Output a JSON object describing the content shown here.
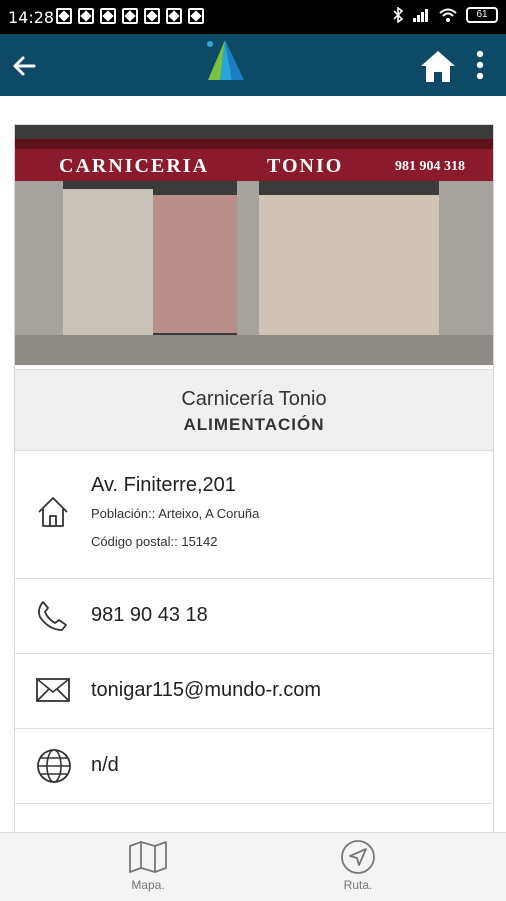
{
  "status_bar": {
    "time": "14:28",
    "battery": "61"
  },
  "appbar": {
    "back_icon": "arrow-left-icon",
    "logo_icon": "app-logo-icon",
    "home_icon": "home-icon",
    "menu_icon": "more-vertical-icon",
    "color": "#0d4a66"
  },
  "business": {
    "photo_sign_left": "CARNICERIA",
    "photo_sign_right": "TONIO",
    "photo_phone": "981 904 318",
    "name": "Carnicería Tonio",
    "category": "ALIMENTACIÓN",
    "address": "Av. Finiterre,201",
    "population": "Población:: Arteixo, A Coruña",
    "postal": "Código postal:: 15142",
    "phone": "981 90 43 18",
    "email": "tonigar115@mundo-r.com",
    "website": "n/d"
  },
  "bottom_nav": {
    "map_label": "Mapa.",
    "route_label": "Ruta."
  }
}
